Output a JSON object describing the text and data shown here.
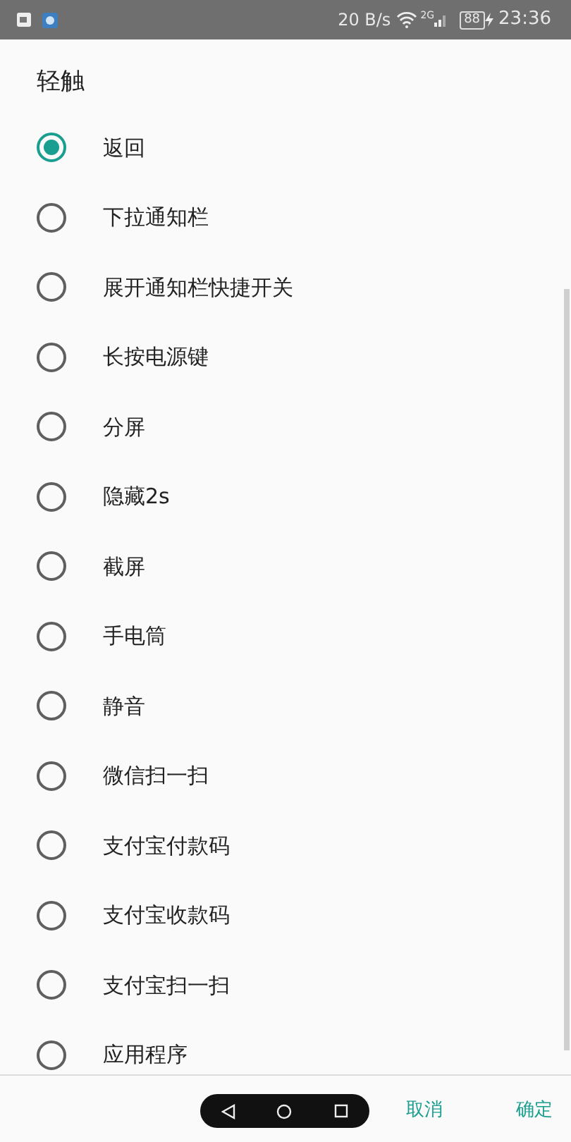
{
  "status_bar": {
    "speed": "20 B/s",
    "network": "2G",
    "battery": "88",
    "time": "23:36"
  },
  "dialog": {
    "title": "轻触",
    "options": [
      {
        "label": "返回",
        "selected": true
      },
      {
        "label": "下拉通知栏",
        "selected": false
      },
      {
        "label": "展开通知栏快捷开关",
        "selected": false
      },
      {
        "label": "长按电源键",
        "selected": false
      },
      {
        "label": "分屏",
        "selected": false
      },
      {
        "label": "隐藏2s",
        "selected": false
      },
      {
        "label": "截屏",
        "selected": false
      },
      {
        "label": "手电筒",
        "selected": false
      },
      {
        "label": "静音",
        "selected": false
      },
      {
        "label": "微信扫一扫",
        "selected": false
      },
      {
        "label": "支付宝付款码",
        "selected": false
      },
      {
        "label": "支付宝收款码",
        "selected": false
      },
      {
        "label": "支付宝扫一扫",
        "selected": false
      },
      {
        "label": "应用程序",
        "selected": false
      }
    ],
    "buttons": [
      "取消",
      "确定"
    ]
  }
}
